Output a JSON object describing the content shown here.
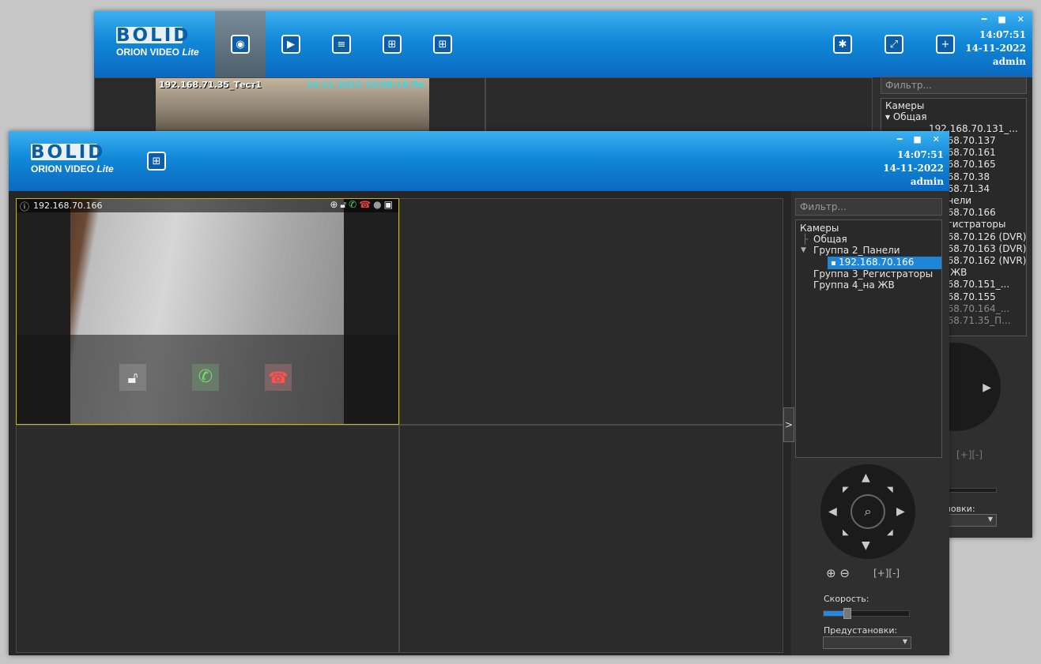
{
  "back_window": {
    "logo": {
      "brand": "BOLID",
      "product": "ORION VIDEO",
      "edition": "Lite"
    },
    "nav_icons": [
      "cameras-icon",
      "archive-icon",
      "reports-icon",
      "plan-icon",
      "layout-icon"
    ],
    "right_icons": [
      "settings-icon",
      "fullscreen-icon",
      "new-window-icon"
    ],
    "time": "14:07:51",
    "date": "14-11-2022",
    "user": "admin",
    "camera_overlay": {
      "name": "192.168.71.35_Тест1",
      "timestamp": "14-11-2022 14:08:18 Пн"
    },
    "filter_placeholder": "Фильтр...",
    "tree": [
      "Камеры",
      "Общая",
      "192.168.70.131_...",
      "168.70.137",
      "168.70.161",
      "168.70.165",
      "168.70.38",
      "168.71.34",
      "анели",
      "168.70.166",
      "егистраторы",
      "168.70.126 (DVR)",
      "168.70.163 (DVR)",
      "168.70.162 (NVR)",
      "а ЖВ",
      "168.70.151_...",
      "168.70.155",
      "168.70.164_...",
      "168.71.35_П..."
    ],
    "zoom_area": "[+][-]",
    "presets_label": "ановки:"
  },
  "front_window": {
    "logo": {
      "brand": "BOLID",
      "product": "ORION VIDEO",
      "edition": "Lite"
    },
    "time": "14:07:51",
    "date": "14-11-2022",
    "user": "admin",
    "camera": {
      "name": "192.168.70.166"
    },
    "filter_placeholder": "Фильтр...",
    "collapse_label": ">",
    "tree": {
      "root": "Камеры",
      "groups": [
        "Общая",
        "Группа 2_Панели",
        "Группа 3_Регистраторы",
        "Группа 4_на ЖВ"
      ],
      "selected": "192.168.70.166"
    },
    "zoom_area": "[+][-]",
    "speed_label": "Скорость:",
    "speed_value": 0.28,
    "presets_label": "Предустановки:"
  }
}
